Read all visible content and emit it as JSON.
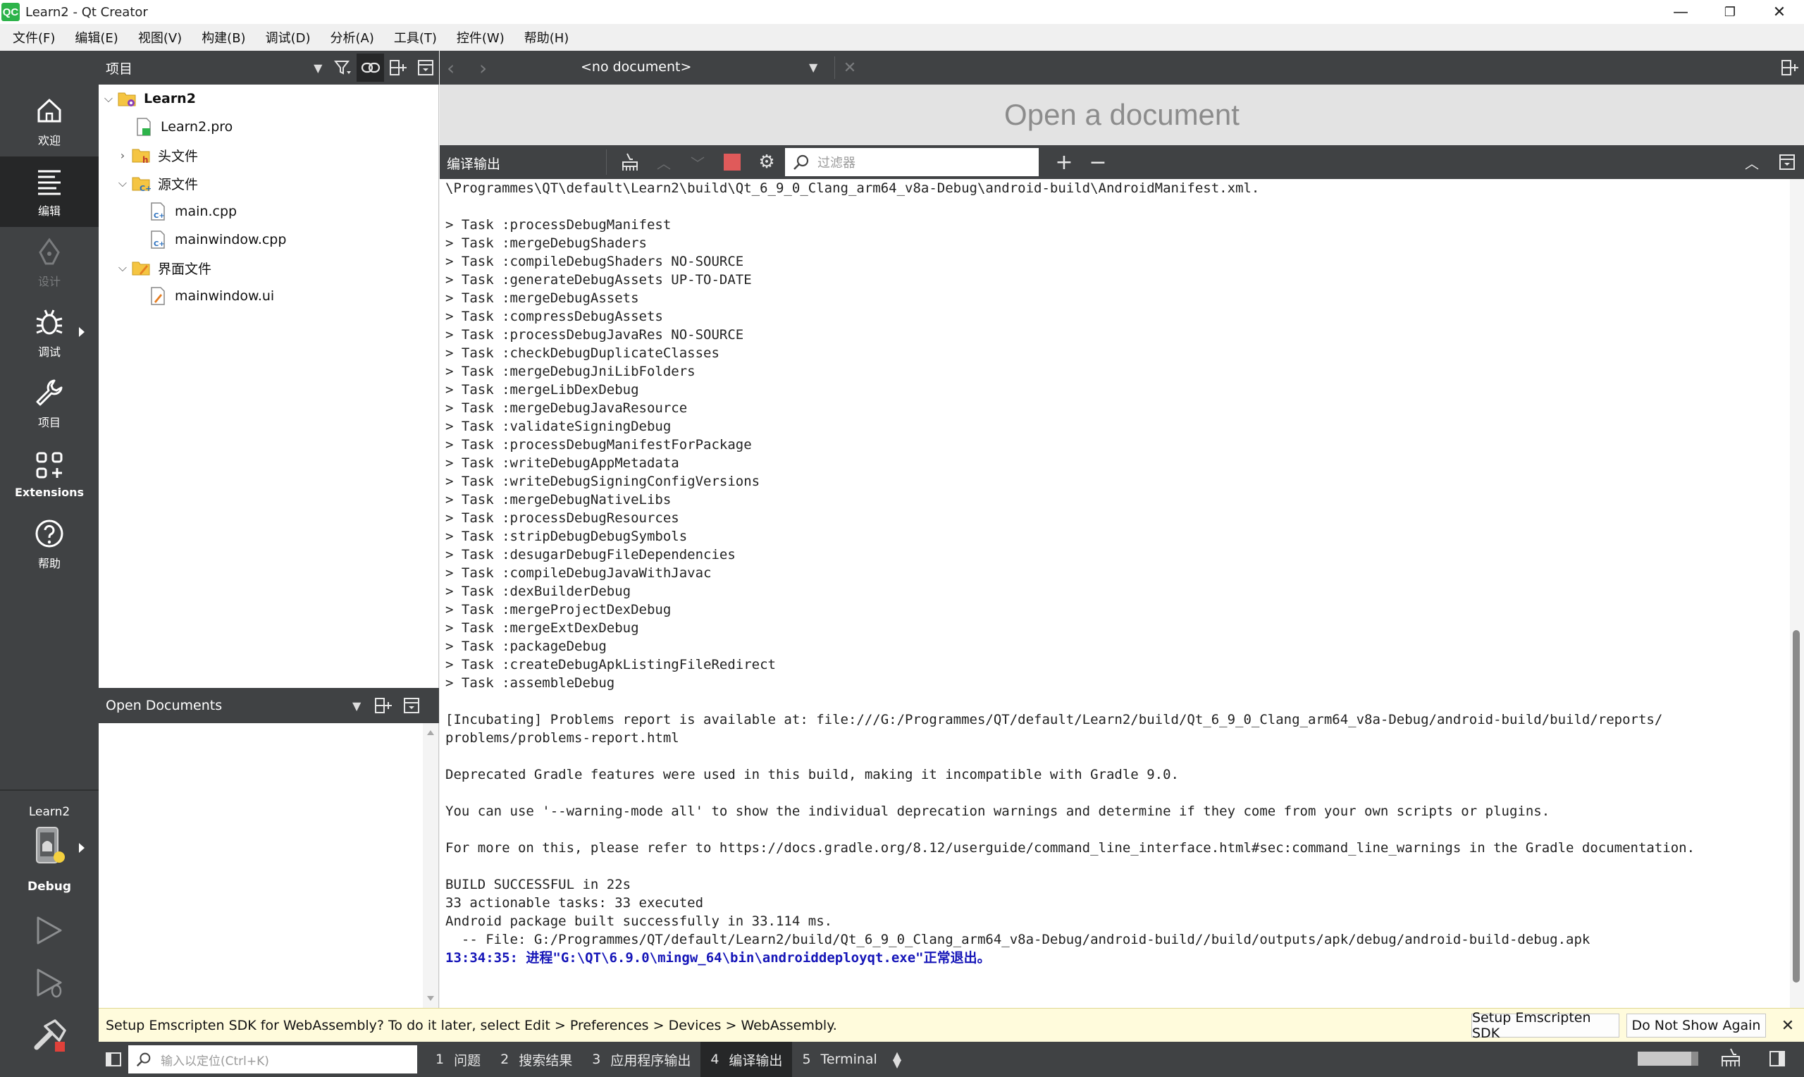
{
  "window": {
    "logo": "QC",
    "title": "Learn2 - Qt Creator",
    "minimize": "—",
    "restore": "❐",
    "close": "✕"
  },
  "menu": [
    "文件(F)",
    "编辑(E)",
    "视图(V)",
    "构建(B)",
    "调试(D)",
    "分析(A)",
    "工具(T)",
    "控件(W)",
    "帮助(H)"
  ],
  "modes": {
    "welcome": "欢迎",
    "edit": "编辑",
    "design": "设计",
    "debug": "调试",
    "projects": "项目",
    "extensions": "Extensions",
    "help": "帮助"
  },
  "kit": {
    "project": "Learn2",
    "build": "Debug"
  },
  "project_panel": {
    "title": "项目",
    "tree": {
      "root": "Learn2",
      "pro": "Learn2.pro",
      "headers": "头文件",
      "sources": "源文件",
      "main_cpp": "main.cpp",
      "mainwindow_cpp": "mainwindow.cpp",
      "forms": "界面文件",
      "mainwindow_ui": "mainwindow.ui"
    }
  },
  "open_documents": {
    "title": "Open Documents"
  },
  "editor": {
    "document_select": "<no document>",
    "placeholder": "Open a document"
  },
  "output_pane": {
    "title": "编译输出",
    "filter_placeholder": "过滤器"
  },
  "output_lines": [
    "\\Programmes\\QT\\default\\Learn2\\build\\Qt_6_9_0_Clang_arm64_v8a-Debug\\android-build\\AndroidManifest.xml.",
    "",
    "> Task :processDebugManifest",
    "> Task :mergeDebugShaders",
    "> Task :compileDebugShaders NO-SOURCE",
    "> Task :generateDebugAssets UP-TO-DATE",
    "> Task :mergeDebugAssets",
    "> Task :compressDebugAssets",
    "> Task :processDebugJavaRes NO-SOURCE",
    "> Task :checkDebugDuplicateClasses",
    "> Task :mergeDebugJniLibFolders",
    "> Task :mergeLibDexDebug",
    "> Task :mergeDebugJavaResource",
    "> Task :validateSigningDebug",
    "> Task :processDebugManifestForPackage",
    "> Task :writeDebugAppMetadata",
    "> Task :writeDebugSigningConfigVersions",
    "> Task :mergeDebugNativeLibs",
    "> Task :processDebugResources",
    "> Task :stripDebugDebugSymbols",
    "> Task :desugarDebugFileDependencies",
    "> Task :compileDebugJavaWithJavac",
    "> Task :dexBuilderDebug",
    "> Task :mergeProjectDexDebug",
    "> Task :mergeExtDexDebug",
    "> Task :packageDebug",
    "> Task :createDebugApkListingFileRedirect",
    "> Task :assembleDebug",
    "",
    "[Incubating] Problems report is available at: file:///G:/Programmes/QT/default/Learn2/build/Qt_6_9_0_Clang_arm64_v8a-Debug/android-build/build/reports/",
    "problems/problems-report.html",
    "",
    "Deprecated Gradle features were used in this build, making it incompatible with Gradle 9.0.",
    "",
    "You can use '--warning-mode all' to show the individual deprecation warnings and determine if they come from your own scripts or plugins.",
    "",
    "For more on this, please refer to https://docs.gradle.org/8.12/userguide/command_line_interface.html#sec:command_line_warnings in the Gradle documentation.",
    "",
    "BUILD SUCCESSFUL in 22s",
    "33 actionable tasks: 33 executed",
    "Android package built successfully in 33.114 ms.",
    "  -- File: G:/Programmes/QT/default/Learn2/build/Qt_6_9_0_Clang_arm64_v8a-Debug/android-build//build/outputs/apk/debug/android-build-debug.apk"
  ],
  "output_final_line": "13:34:35: 进程\"G:\\QT\\6.9.0\\mingw_64\\bin\\androiddeployqt.exe\"正常退出。",
  "notification": {
    "text": "Setup Emscripten SDK for WebAssembly? To do it later, select Edit > Preferences > Devices > WebAssembly.",
    "setup_button": "Setup Emscripten SDK",
    "dismiss_button": "Do Not Show Again"
  },
  "statusbar": {
    "locator_placeholder": "输入以定位(Ctrl+K)",
    "tabs": [
      {
        "num": "1",
        "label": "问题"
      },
      {
        "num": "2",
        "label": "搜索结果"
      },
      {
        "num": "3",
        "label": "应用程序输出"
      },
      {
        "num": "4",
        "label": "编译输出"
      },
      {
        "num": "5",
        "label": "Terminal"
      }
    ]
  }
}
